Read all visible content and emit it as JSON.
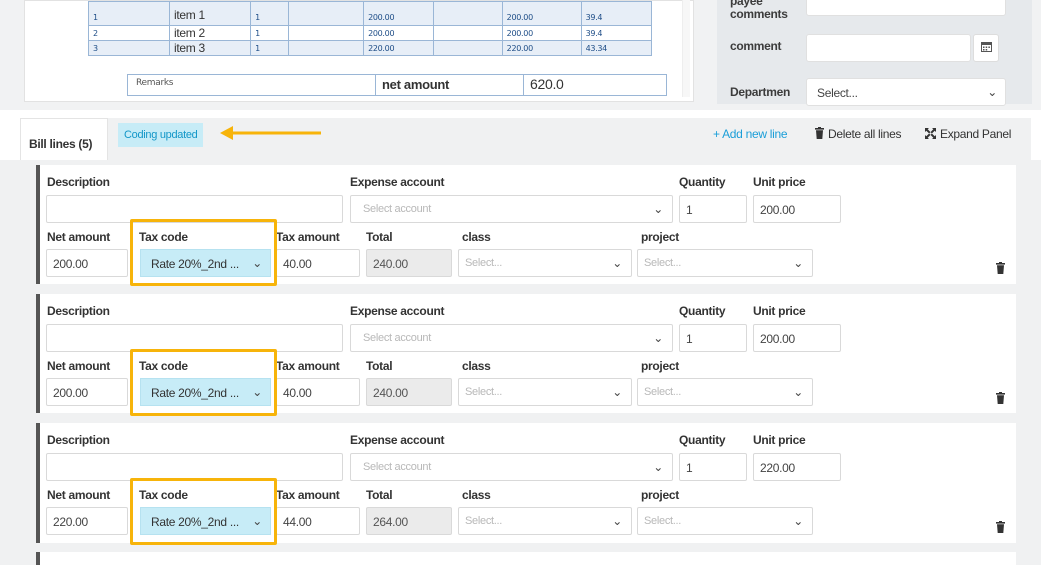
{
  "invoice": {
    "items": [
      {
        "num": "1",
        "name": "item 1",
        "qty": "1",
        "price": "200.00",
        "net": "200.00",
        "tax": "39.4"
      },
      {
        "num": "2",
        "name": "item 2",
        "qty": "1",
        "price": "200.00",
        "net": "200.00",
        "tax": "39.4"
      },
      {
        "num": "3",
        "name": "item 3",
        "qty": "1",
        "price": "220.00",
        "net": "220.00",
        "tax": "43.34"
      }
    ],
    "remarks_label": "Remarks",
    "net_amount_label": "net amount",
    "net_amount_value": "620.0"
  },
  "side_panel": {
    "payee_comments_label": "payee comments",
    "comment_label": "comment",
    "department_label": "Departmen",
    "department_value": "Select..."
  },
  "tabs": {
    "bill_lines": "Bill lines (5)",
    "coding_updated": "Coding updated"
  },
  "actions": {
    "add_line": "+ Add new line",
    "delete_all": "Delete all lines",
    "expand": "Expand Panel"
  },
  "labels": {
    "description": "Description",
    "expense_account": "Expense account",
    "quantity": "Quantity",
    "unit_price": "Unit price",
    "net_amount": "Net amount",
    "tax_code": "Tax code",
    "tax_amount": "Tax amount",
    "total": "Total",
    "class": "class",
    "project": "project"
  },
  "placeholders": {
    "account": "Select account",
    "select": "Select..."
  },
  "lines": [
    {
      "description": "",
      "quantity": "1",
      "unit_price": "200.00",
      "net_amount": "200.00",
      "tax_code": "Rate 20%_2nd ...",
      "tax_amount": "40.00",
      "total": "240.00"
    },
    {
      "description": "",
      "quantity": "1",
      "unit_price": "200.00",
      "net_amount": "200.00",
      "tax_code": "Rate 20%_2nd ...",
      "tax_amount": "40.00",
      "total": "240.00"
    },
    {
      "description": "",
      "quantity": "1",
      "unit_price": "220.00",
      "net_amount": "220.00",
      "tax_code": "Rate 20%_2nd ...",
      "tax_amount": "44.00",
      "total": "264.00"
    }
  ],
  "colors": {
    "highlight": "#f7b40a",
    "coding_tab_bg": "#c7ecf7",
    "link_blue": "#1a9ed8"
  },
  "icons": {
    "calendar": "calendar-icon",
    "trash": "trash-icon",
    "expand": "expand-icon",
    "chevron": "chevron-down-icon",
    "arrow": "arrow-left-icon"
  }
}
